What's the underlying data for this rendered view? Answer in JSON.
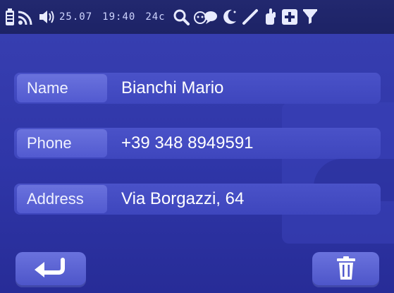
{
  "status_bar": {
    "date": "25.07",
    "time": "19:40",
    "temperature": "24c",
    "icons": [
      "battery-icon",
      "wifi-icon",
      "volume-icon",
      "search-icon",
      "chat-icon",
      "moon-icon",
      "pen-icon",
      "hand-icon",
      "plus-icon",
      "funnel-icon"
    ]
  },
  "contact": {
    "fields": [
      {
        "label": "Name",
        "value": "Bianchi Mario"
      },
      {
        "label": "Phone",
        "value": "+39 348 8949591"
      },
      {
        "label": "Address",
        "value": "Via Borgazzi, 64"
      }
    ]
  },
  "bottom_bar": {
    "buttons": [
      "back-icon",
      "trash-icon"
    ]
  },
  "colors": {
    "background": "#2f36a8",
    "status_bar": "#1d2366",
    "row": "#4149c0",
    "label": "#5c64d6",
    "text": "#ffffff"
  }
}
